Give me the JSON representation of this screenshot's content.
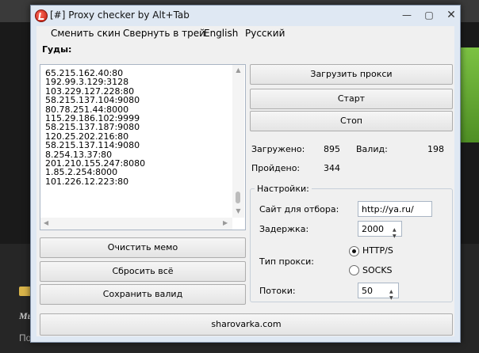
{
  "window": {
    "title": "[#] Proxy checker by Alt+Tab",
    "min_glyph": "—",
    "max_glyph": "▢",
    "close_glyph": "✕"
  },
  "menu": [
    {
      "label": "Сменить скин"
    },
    {
      "label": "Свернуть в трей"
    },
    {
      "label": "English"
    },
    {
      "label": "Русский"
    }
  ],
  "memo": {
    "label": "Гуды:",
    "lines": [
      "65.215.162.40:80",
      "192.99.3.129:3128",
      "103.229.127.228:80",
      "58.215.137.104:9080",
      "80.78.251.44:8000",
      "115.29.186.102:9999",
      "58.215.137.187:9080",
      "120.25.202.216:80",
      "58.215.137.114:9080",
      "8.254.13.37:80",
      "201.210.155.247:8080",
      "1.85.2.254:8000",
      "101.226.12.223:80"
    ]
  },
  "buttons": {
    "load_proxy": "Загрузить прокси",
    "start": "Старт",
    "stop": "Стоп",
    "clear_memo": "Очистить мемо",
    "reset_all": "Сбросить всё",
    "save_valid": "Сохранить валид",
    "site": "sharovarka.com"
  },
  "stats": {
    "loaded_label": "Загружено:",
    "loaded_value": "895",
    "valid_label": "Валид:",
    "valid_value": "198",
    "passed_label": "Пройдено:",
    "passed_value": "344"
  },
  "settings": {
    "title": "Настройки:",
    "site_label": "Сайт для отбора:",
    "site_value": "http://ya.ru/",
    "delay_label": "Задержка:",
    "delay_value": "2000",
    "proxy_type_label": "Тип прокси:",
    "http_label": "HTTP/S",
    "socks_label": "SOCKS",
    "selected_type": "HTTP/S",
    "threads_label": "Потоки:",
    "threads_value": "50"
  },
  "background": {
    "heading": "Мы",
    "line": "По"
  },
  "colors": {
    "window_frame": "#dfe8f3",
    "client": "#f0f0f0",
    "accent_green": "#7cc243"
  }
}
